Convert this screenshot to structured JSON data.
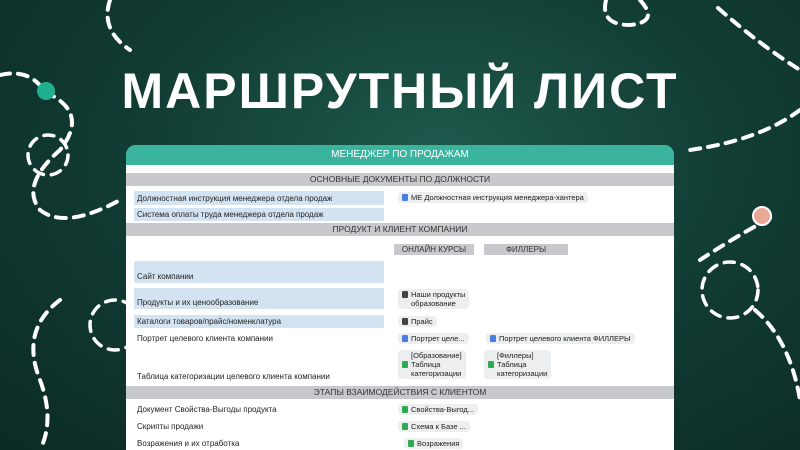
{
  "title": "МАРШРУТНЫЙ ЛИСТ",
  "card_header": "МЕНЕДЖЕР ПО ПРОДАЖАМ",
  "sections": {
    "s1": "ОСНОВНЫЕ ДОКУМЕНТЫ ПО ДОЛЖНОСТИ",
    "s2": "ПРОДУКТ И КЛИЕНТ КОМПАНИИ",
    "s3": "ЭТАПЫ ВЗАИМОДЕЙСТВИЯ С КЛИЕНТОМ"
  },
  "columns": {
    "c1": "ОНЛАЙН КУРСЫ",
    "c2": "ФИЛЛЕРЫ"
  },
  "rows": {
    "r1": "Должностная инструкция менеджера отдела продаж",
    "r2": "Система оплаты труда менеджера отдела продаж",
    "r3": "Сайт компании",
    "r4": "Продукты и их ценообразование",
    "r5": "Каталоги товаров/прайс/номенклатура",
    "r6": "Портрет целевого клиента компании",
    "r7": "Таблица категоризации целевого клиента компании",
    "r8": "Документ Свойства-Выгоды продукта",
    "r9": "Скрипты продажи",
    "r10": "Возражения и их отработка"
  },
  "chips": {
    "k1": "МЕ Должностная инструкция менеджера-хантера",
    "k2a": "Наши продукты",
    "k2b": "образование",
    "k3": "Прайс",
    "k4": "Портрет целе...",
    "k5": "Портрет целевого клиента ФИЛЛЕРЫ",
    "k6a": "[Образование]",
    "k6b": "Таблица",
    "k6c": "категоризации",
    "k7a": "[Филлеры]",
    "k7b": "Таблица",
    "k7c": "категоризации",
    "k8": "Свойства-Выгод...",
    "k9": "Схема к Базе ...",
    "k10": "Возражения"
  },
  "colors": {
    "accent": "#3ab39f",
    "background": "#123e35",
    "row_highlight": "#d3e3f2",
    "section_bar": "#c7c9cc"
  }
}
